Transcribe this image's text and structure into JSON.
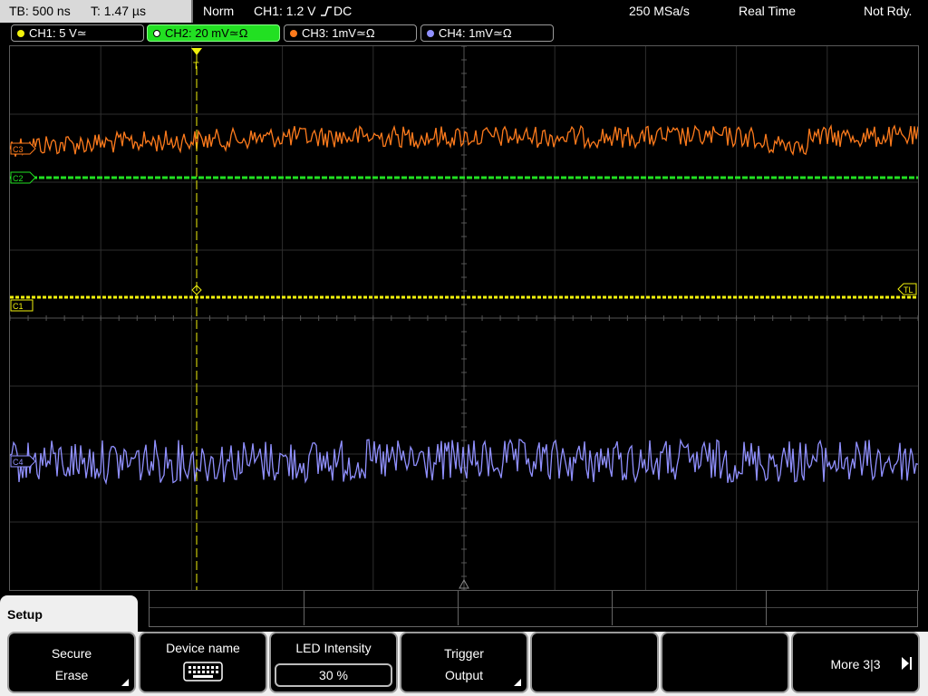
{
  "status_bar": {
    "timebase": "TB: 500 ns",
    "trigger_time": "T: 1.47 µs",
    "trigger_mode": "Norm",
    "trigger_source": "CH1: 1.2 V",
    "trigger_edge_icon": "rising-edge-icon",
    "trigger_coupling": "DC",
    "sample_rate": "250 MSa/s",
    "acquisition_mode": "Real Time",
    "status": "Not Rdy."
  },
  "channels": [
    {
      "label": "CH1: 5 V≃",
      "color": "#f2f20c",
      "active": false
    },
    {
      "label": "CH2: 20 mV≃Ω",
      "color": "#22e022",
      "active": true
    },
    {
      "label": "CH3: 1mV≃Ω",
      "color": "#ff7b1c",
      "active": false
    },
    {
      "label": "CH4: 1mV≃Ω",
      "color": "#9090ff",
      "active": false
    }
  ],
  "markers": {
    "c1": "C1",
    "c2": "C2",
    "c3": "C3",
    "c4": "C4",
    "trigger_level": "TL",
    "trigger_pos": "T"
  },
  "menu": {
    "title": "Setup",
    "softkeys": [
      {
        "line1": "Secure",
        "line2": "Erase"
      },
      {
        "line1": "Device name",
        "icon": "keyboard-icon"
      },
      {
        "line1": "LED Intensity",
        "value": "30 %"
      },
      {
        "line1": "Trigger",
        "line2": "Output"
      },
      {
        "line1": ""
      },
      {
        "line1": ""
      },
      {
        "line1": "More 3|3"
      }
    ]
  },
  "colors": {
    "ch1": "#f2f20c",
    "ch2": "#22e022",
    "ch3": "#ff7b1c",
    "ch4": "#9090ff",
    "grid": "#3a3a3a"
  }
}
